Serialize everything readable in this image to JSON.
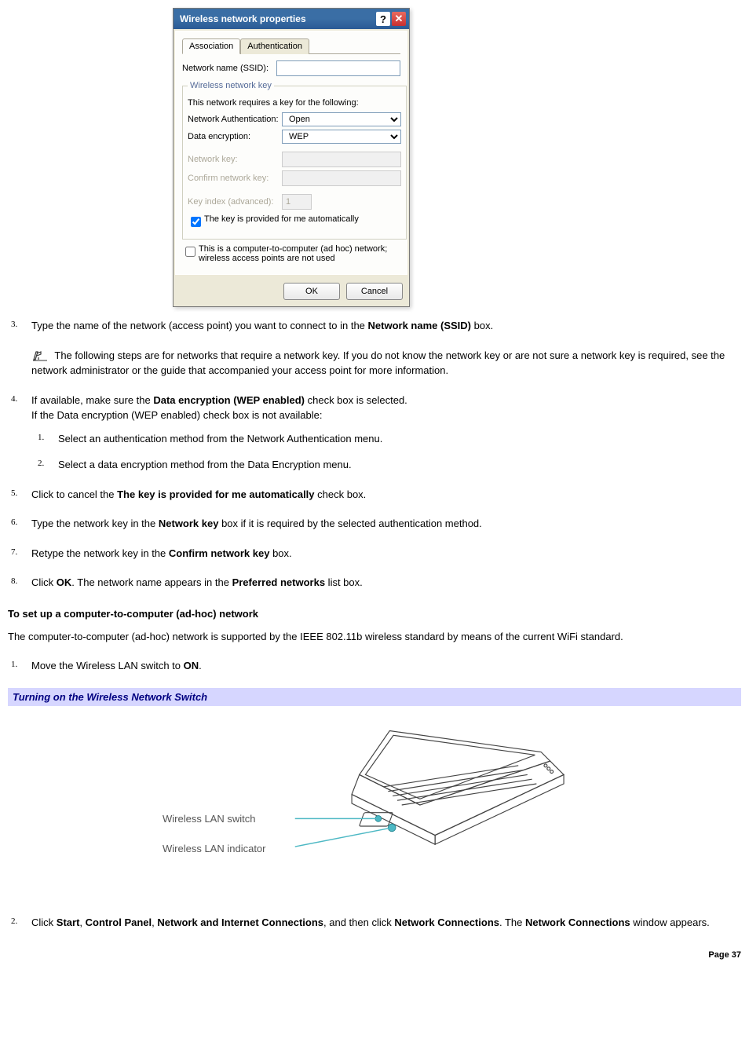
{
  "dialog": {
    "title": "Wireless network properties",
    "tabs": [
      "Association",
      "Authentication"
    ],
    "ssid_label": "Network name (SSID):",
    "ssid_value": "",
    "fieldset_legend": "Wireless network key",
    "fieldset_intro": "This network requires a key for the following:",
    "auth_label": "Network Authentication:",
    "auth_value": "Open",
    "enc_label": "Data encryption:",
    "enc_value": "WEP",
    "key_label": "Network key:",
    "confirm_label": "Confirm network key:",
    "index_label": "Key index (advanced):",
    "index_value": "1",
    "auto_label": "The key is provided for me automatically",
    "adhoc_label": "This is a computer-to-computer (ad hoc) network; wireless access points are not used",
    "ok": "OK",
    "cancel": "Cancel"
  },
  "steps_a": {
    "s3_a": "Type the name of the network (access point) you want to connect to in the ",
    "s3_b": "Network name (SSID)",
    "s3_c": " box.",
    "note": "The following steps are for networks that require a network key. If you do not know the network key or are not sure a network key is required, see the network administrator or the guide that accompanied your access point for more information.",
    "s4_a": "If available, make sure the ",
    "s4_b": "Data encryption (WEP enabled)",
    "s4_c": " check box is selected.",
    "s4_d": "If the Data encryption (WEP enabled) check box is not available:",
    "s4_1": "Select an authentication method from the Network Authentication menu.",
    "s4_2": "Select a data encryption method from the Data Encryption menu.",
    "s5_a": "Click to cancel the ",
    "s5_b": "The key is provided for me automatically",
    "s5_c": " check box.",
    "s6_a": "Type the network key in the ",
    "s6_b": "Network key",
    "s6_c": " box if it is required by the selected authentication method.",
    "s7_a": "Retype the network key in the ",
    "s7_b": "Confirm network key",
    "s7_c": " box.",
    "s8_a": "Click ",
    "s8_b": "OK",
    "s8_c": ". The network name appears in the ",
    "s8_d": "Preferred networks",
    "s8_e": " list box."
  },
  "adhoc": {
    "heading": "To set up a computer-to-computer (ad-hoc) network",
    "intro": "The computer-to-computer (ad-hoc) network is supported by the IEEE 802.11b wireless standard by means of the current WiFi standard.",
    "s1_a": "Move the Wireless LAN switch to ",
    "s1_b": "ON",
    "s1_c": ".",
    "caption": "Turning on the Wireless Network Switch",
    "fig_label1": "Wireless LAN switch",
    "fig_label2": "Wireless LAN indicator",
    "s2_a": "Click ",
    "s2_b": "Start",
    "s2_c": ", ",
    "s2_d": "Control Panel",
    "s2_e": ", ",
    "s2_f": "Network and Internet Connections",
    "s2_g": ", and then click ",
    "s2_h": "Network Connections",
    "s2_i": ". The ",
    "s2_j": "Network Connections",
    "s2_k": " window appears."
  },
  "footer": "Page 37"
}
